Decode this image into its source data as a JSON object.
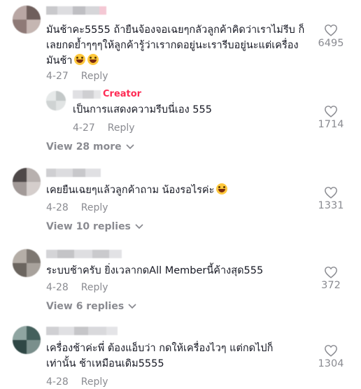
{
  "comments": [
    {
      "text_line1": "มันช้าคะ5555 ถ้ายืนจ้องจอเฉยๆกลัวลูกค้าคิดว่าเราไม่รีบ ก็",
      "text_line2": "เลยกดย้ำๆๆๆให้ลูกค้ารู้ว่าเรากดอยู่นะเรารีบอยู่นะแต่เครื่อง",
      "text_line3": "มันช้า",
      "date": "4-27",
      "reply": "Reply",
      "likes": "6495",
      "emoji": [
        "tears-of-joy-emoji",
        "tears-of-joy-emoji"
      ]
    },
    {
      "creator_label": "Creator",
      "text_line1": "เป็นการแสดงความรีบนี่เอง 555",
      "date": "4-27",
      "reply": "Reply",
      "likes": "1714"
    },
    {
      "text_line1": "เคยยืนเฉยๆแล้วลูกค้าถาม น้องรอไรค่ะ",
      "date": "4-28",
      "reply": "Reply",
      "likes": "1331",
      "emoji": [
        "tears-of-joy-emoji"
      ]
    },
    {
      "text_line1": "ระบบช้าครับ ยิ่งเวลากดAll Memberนี้ค้างสุด555",
      "date": "4-28",
      "reply": "Reply",
      "likes": "372"
    },
    {
      "text_line1": "เครื่องช้าค่ะพี่ ต้องแอ็บว่า กดให้เครื่องไวๆ แต่กดไปก็",
      "text_line2": "เท่านั้น ช้าเหมือนเดิม5555",
      "date": "4-28",
      "reply": "Reply",
      "likes": "1304"
    }
  ],
  "view_more": {
    "first": "View 28 more",
    "second": "View 10 replies",
    "third": "View 6 replies"
  },
  "colors": {
    "text": "#161823",
    "muted": "#8a8b91",
    "creator": "#fe2c55",
    "emoji": "#ffc83d"
  },
  "icons": [
    "heart-outline-icon",
    "chevron-down-icon",
    "avatar-blurred"
  ]
}
